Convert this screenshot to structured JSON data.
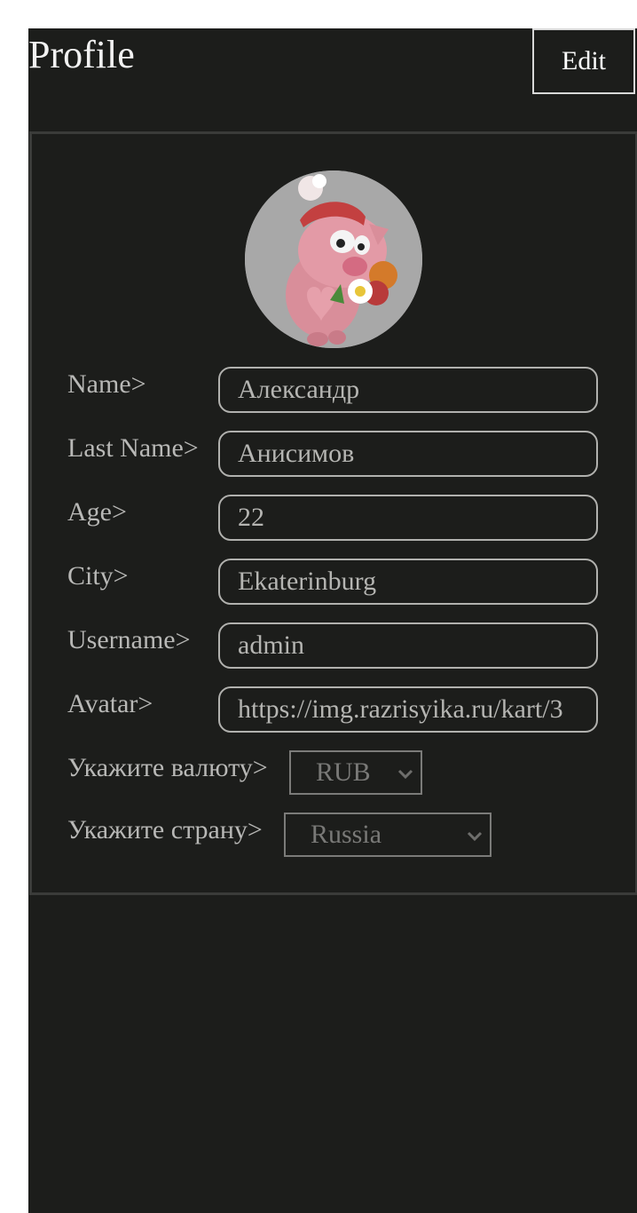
{
  "header": {
    "title": "Profile",
    "edit_label": "Edit"
  },
  "profile": {
    "avatar_icon": "pig-character-avatar",
    "fields": {
      "name": {
        "label": "Name>",
        "value": "Александр"
      },
      "last_name": {
        "label": "Last Name>",
        "value": "Анисимов"
      },
      "age": {
        "label": "Age>",
        "value": "22"
      },
      "city": {
        "label": "City>",
        "value": "Ekaterinburg"
      },
      "username": {
        "label": "Username>",
        "value": "admin"
      },
      "avatar": {
        "label": "Avatar>",
        "value": "https://img.razrisyika.ru/kart/3"
      }
    },
    "currency": {
      "label": "Укажите валюту>",
      "selected": "RUB"
    },
    "country": {
      "label": "Укажите страну>",
      "selected": "Russia"
    }
  },
  "colors": {
    "background": "#1c1d1b",
    "text": "#b8b8b6",
    "border": "#b1b1ae"
  }
}
